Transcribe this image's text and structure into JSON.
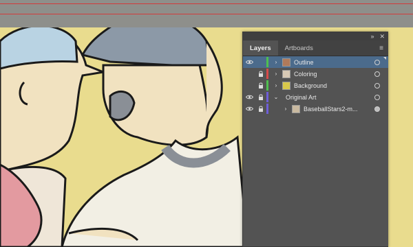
{
  "panel": {
    "header_icons": [
      "collapse-icon",
      "close-icon"
    ],
    "tabs": [
      {
        "label": "Layers",
        "active": true
      },
      {
        "label": "Artboards",
        "active": false
      }
    ],
    "menu_icon": "hamburger-menu-icon"
  },
  "layers": [
    {
      "name": "Outline",
      "visible": true,
      "locked": false,
      "expanded": false,
      "color": "#4fbf4f",
      "selected": true,
      "target_filled": false,
      "level": 0
    },
    {
      "name": "Coloring",
      "visible": false,
      "locked": true,
      "expanded": false,
      "color": "#d84a4a",
      "selected": false,
      "target_filled": false,
      "level": 0
    },
    {
      "name": "Background",
      "visible": false,
      "locked": true,
      "expanded": false,
      "color": "#4fbf4f",
      "selected": false,
      "target_filled": false,
      "level": 0
    },
    {
      "name": "Original Art",
      "visible": true,
      "locked": true,
      "expanded": true,
      "color": "#6e5fd8",
      "selected": false,
      "target_filled": false,
      "level": 0
    },
    {
      "name": "BaseballStars2-m...",
      "visible": true,
      "locked": true,
      "expanded": false,
      "color": "#6e5fd8",
      "selected": false,
      "target_filled": true,
      "level": 1
    }
  ],
  "colors": {
    "panel_bg": "#535353",
    "selection": "#4b6b8c",
    "canvas_bg": "#e9dc8e"
  }
}
